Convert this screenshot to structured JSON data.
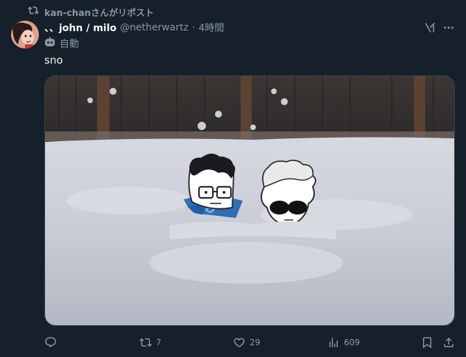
{
  "repost": {
    "text": "kan-chanさんがリポスト",
    "icon": "repost-icon"
  },
  "author": {
    "display_name": "、、john / milo",
    "handle": "@netherwartz",
    "separator": "·",
    "time": "4時間"
  },
  "automated": {
    "icon": "bot-icon",
    "label": "自動"
  },
  "tweet": {
    "text": "sno"
  },
  "actions": {
    "reply": {
      "icon": "reply-icon",
      "count": ""
    },
    "repost": {
      "icon": "repost-icon",
      "count": "7"
    },
    "like": {
      "icon": "heart-icon",
      "count": "29"
    },
    "views": {
      "icon": "views-icon",
      "count": "609"
    },
    "bookmark": {
      "icon": "bookmark-icon"
    },
    "share": {
      "icon": "share-icon"
    }
  },
  "colors": {
    "background": "#15202b",
    "text_primary": "#f7f9f9",
    "text_secondary": "#8b98a5",
    "border": "#38444d"
  }
}
